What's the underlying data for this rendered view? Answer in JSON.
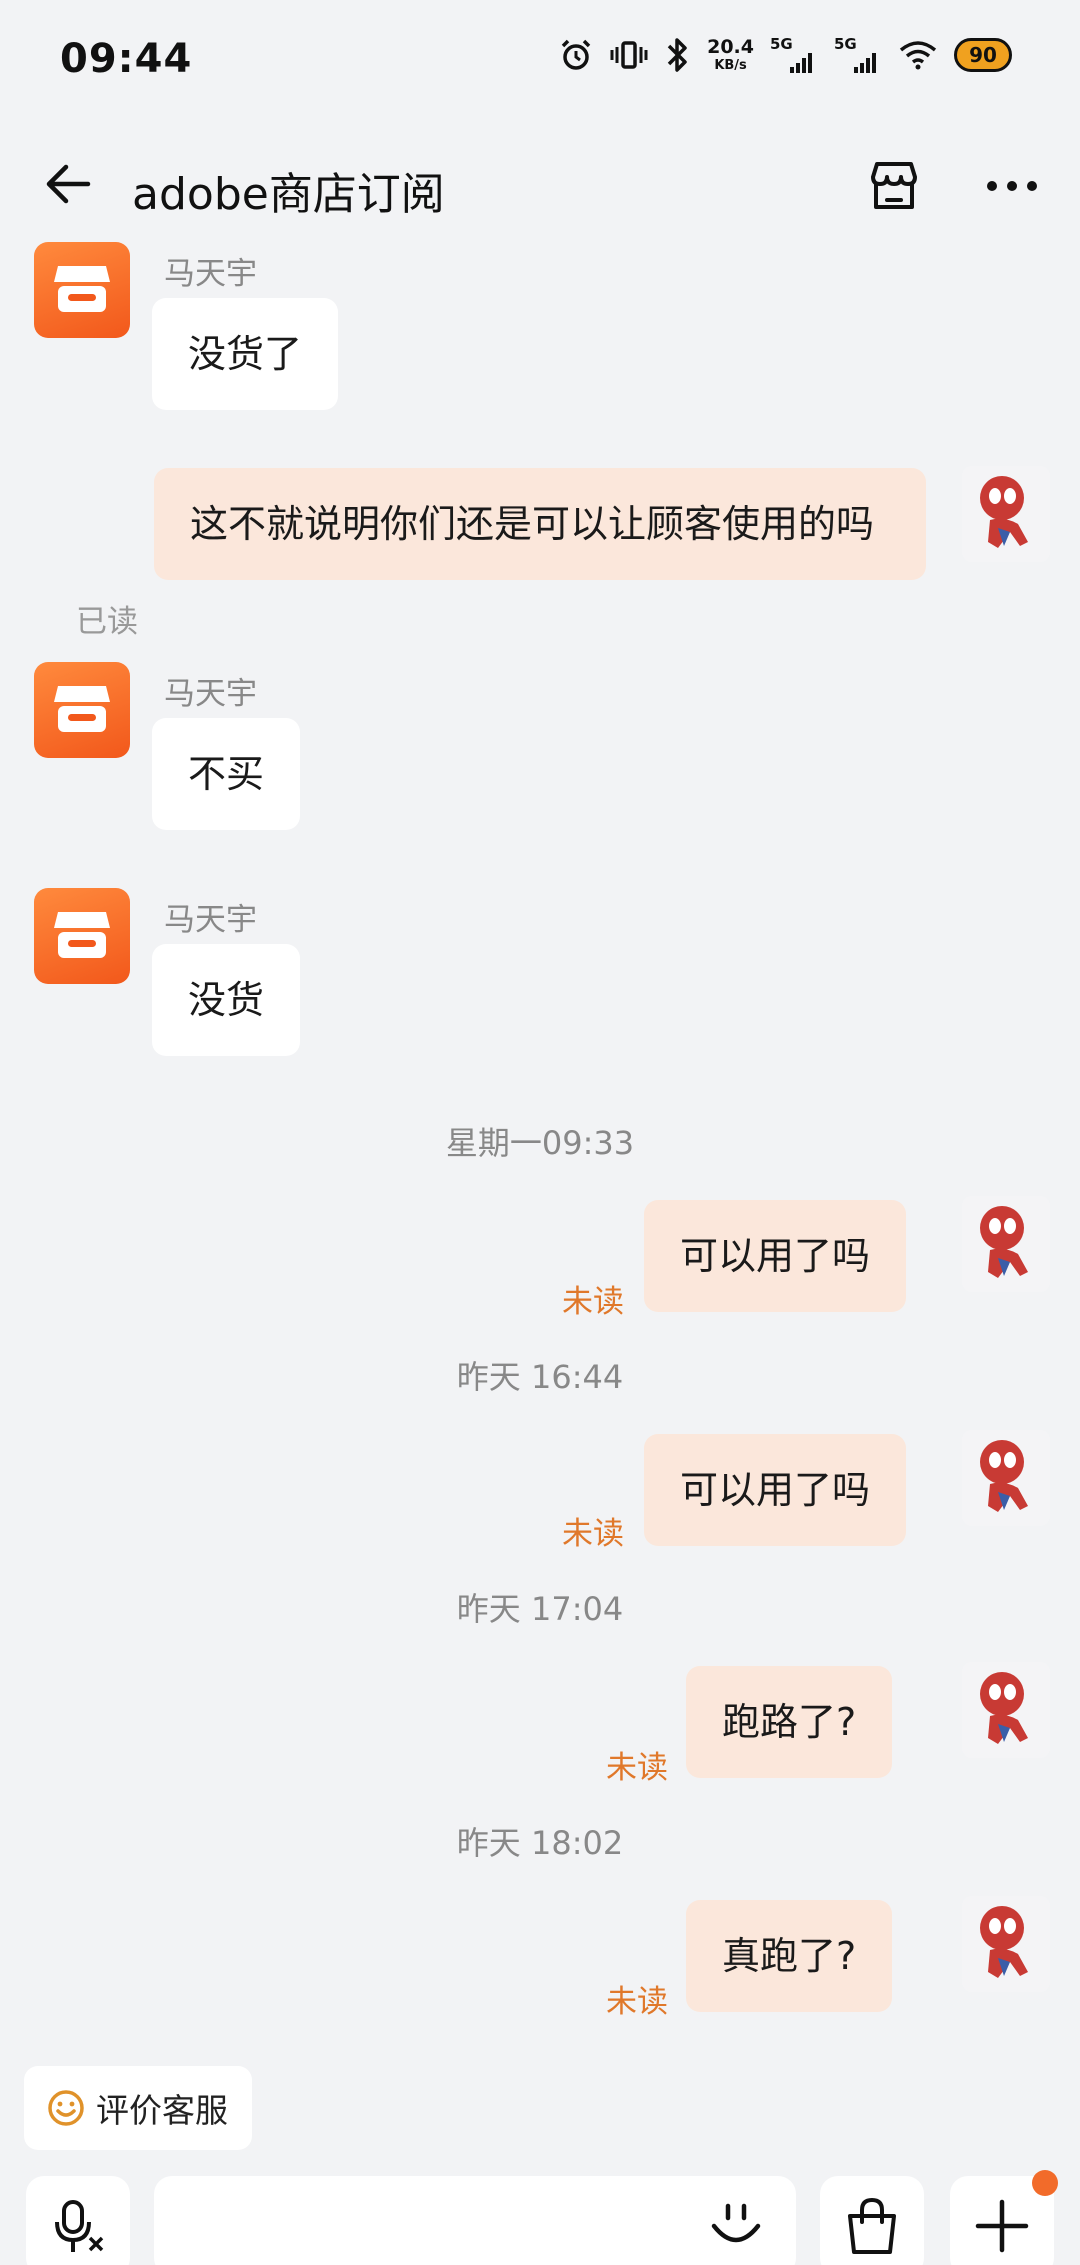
{
  "status_bar": {
    "time": "09:44",
    "net_speed_value": "20.4",
    "net_speed_unit": "KB/s",
    "sim1_label": "5G",
    "sim2_label": "5G",
    "battery": "90"
  },
  "nav": {
    "title": "adobe商店订阅"
  },
  "colors": {
    "accent_orange": "#f26b2a",
    "outgoing_bubble": "#fbe7db",
    "unread_text": "#e0782a"
  },
  "messages": [
    {
      "sender": "马天宇",
      "text": "没货了"
    },
    {
      "text": "这不就说明你们还是可以让顾客使用的吗",
      "status": "已读"
    },
    {
      "sender": "马天宇",
      "text": "不买"
    },
    {
      "sender": "马天宇",
      "text": "没货"
    },
    {
      "timestamp": "星期一09:33"
    },
    {
      "text": "可以用了吗",
      "status": "未读"
    },
    {
      "timestamp": "昨天 16:44"
    },
    {
      "text": "可以用了吗",
      "status": "未读"
    },
    {
      "timestamp": "昨天 17:04"
    },
    {
      "text": "跑路了?",
      "status": "未读"
    },
    {
      "timestamp": "昨天 18:02"
    },
    {
      "text": "真跑了?",
      "status": "未读"
    }
  ],
  "bottom": {
    "rate_label": "评价客服"
  },
  "icons": {
    "back": "arrow-left-icon",
    "shop": "store-icon",
    "more": "more-dots-icon",
    "voice": "voice-translate-icon",
    "emoji": "smile-icon",
    "bag": "shopping-bag-icon",
    "plus": "plus-icon"
  }
}
